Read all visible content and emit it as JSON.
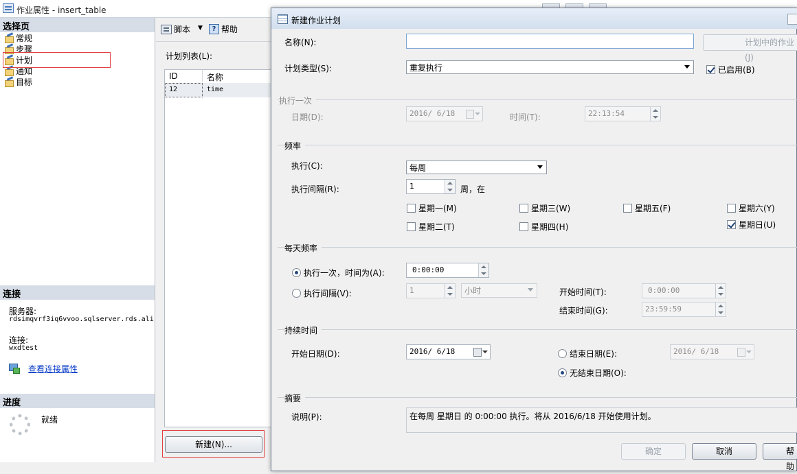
{
  "back_window": {
    "title": "作业属性 - insert_table",
    "left_pane": {
      "select_page_header": "选择页",
      "pages": [
        "常规",
        "步骤",
        "计划",
        "通知",
        "目标"
      ],
      "connection_header": "连接",
      "server_label": "服务器:",
      "server_value": "rdsimqvrf3iq6vvoo.sqlserver.rds.ali",
      "connection_label": "连接:",
      "connection_value": "wxdtest",
      "view_connection_link": "查看连接属性",
      "progress_header": "进度",
      "progress_status": "就绪"
    },
    "toolbar": {
      "script_label": "脚本",
      "help_label": "帮助"
    },
    "schedule_list": {
      "label": "计划列表(L):",
      "columns": [
        "ID",
        "名称"
      ],
      "rows": [
        {
          "id": "12",
          "name": "time"
        }
      ]
    },
    "new_button": "新建(N)..."
  },
  "dialog": {
    "title": "新建作业计划",
    "name_label": "名称(N):",
    "name_value": "",
    "jobs_in_schedule_button": "计划中的作业(J)",
    "schedule_type_label": "计划类型(S):",
    "schedule_type_value": "重复执行",
    "enabled_label": "已启用(B)",
    "enabled_checked": true,
    "one_time": {
      "group_title": "执行一次",
      "date_label": "日期(D):",
      "date_value": "2016/ 6/18",
      "time_label": "时间(T):",
      "time_value": "22:13:54"
    },
    "frequency": {
      "group_title": "频率",
      "occurs_label": "执行(C):",
      "occurs_value": "每周",
      "recurs_label": "执行间隔(R):",
      "recurs_value": "1",
      "recurs_suffix": "周，在",
      "days": [
        {
          "label": "星期一(M)",
          "checked": false
        },
        {
          "label": "星期三(W)",
          "checked": false
        },
        {
          "label": "星期五(F)",
          "checked": false
        },
        {
          "label": "星期六(Y)",
          "checked": false
        },
        {
          "label": "星期二(T)",
          "checked": false
        },
        {
          "label": "星期四(H)",
          "checked": false
        },
        {
          "label": "星期日(U)",
          "checked": true
        }
      ]
    },
    "daily_frequency": {
      "group_title": "每天频率",
      "once_label": "执行一次，时间为(A):",
      "once_selected": true,
      "once_time": "0:00:00",
      "every_label": "执行间隔(V):",
      "every_value": "1",
      "every_unit": "小时",
      "start_time_label": "开始时间(T):",
      "start_time_value": "0:00:00",
      "end_time_label": "结束时间(G):",
      "end_time_value": "23:59:59"
    },
    "duration": {
      "group_title": "持续时间",
      "start_date_label": "开始日期(D):",
      "start_date_value": "2016/ 6/18",
      "end_date_label": "结束日期(E):",
      "end_date_value": "2016/ 6/18",
      "no_end_label": "无结束日期(O):",
      "no_end_selected": true
    },
    "summary": {
      "group_title": "摘要",
      "description_label": "说明(P):",
      "description_value": "在每周 星期日 的 0:00:00 执行。将从 2016/6/18 开始使用计划。"
    },
    "buttons": {
      "ok": "确定",
      "cancel": "取消",
      "help": "帮助"
    }
  },
  "colors": {
    "header_bg": "#d6dde7",
    "highlight_red": "#e04040",
    "link_blue": "#0b3fc8"
  },
  "icons": [
    "app-icon",
    "page-icon",
    "script-icon",
    "help-icon",
    "connection-properties-icon",
    "progress-spinner-icon",
    "calendar-icon",
    "schedule-icon"
  ]
}
